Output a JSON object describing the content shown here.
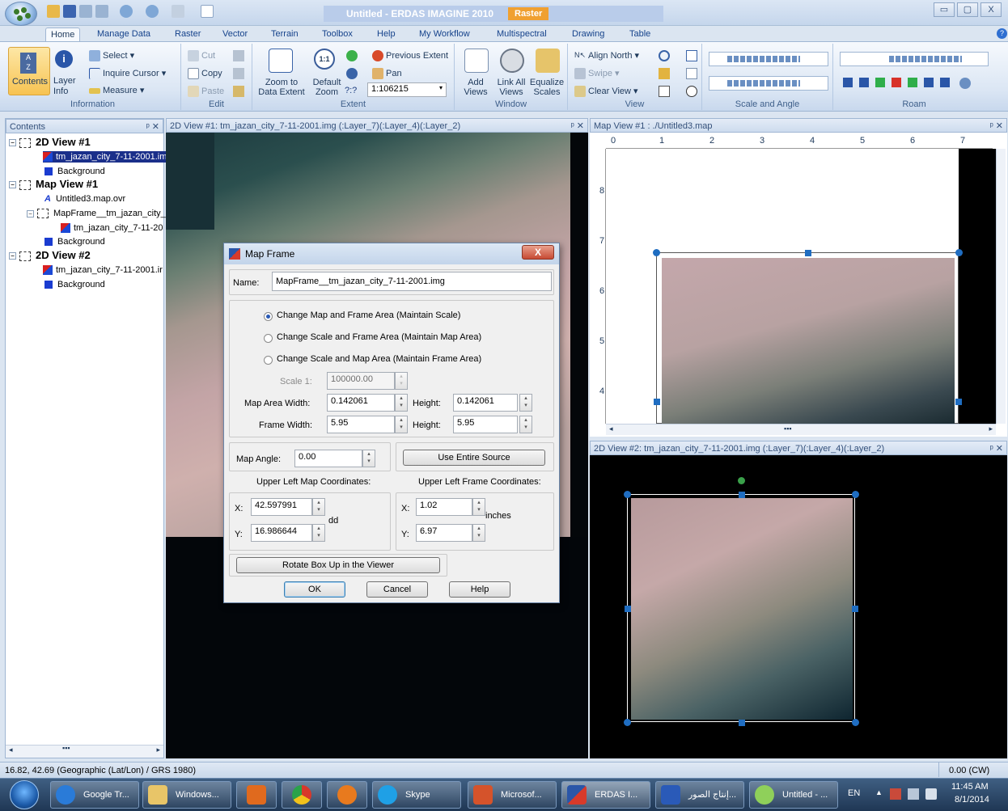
{
  "window": {
    "title": "Untitled - ERDAS IMAGINE 2010",
    "context_tab": "Raster",
    "minimize": "▭",
    "maximize": "▢",
    "close": "X",
    "help_icon": "help-icon"
  },
  "tabs": [
    "Home",
    "Manage Data",
    "Raster",
    "Vector",
    "Terrain",
    "Toolbox",
    "Help",
    "My Workflow",
    "Multispectral",
    "Drawing",
    "Table"
  ],
  "ribbon": {
    "information": {
      "label": "Information",
      "contents": "Contents",
      "layer_info": "Layer Info",
      "select": "Select",
      "inquire_cursor": "Inquire Cursor",
      "measure": "Measure"
    },
    "edit": {
      "label": "Edit",
      "cut": "Cut",
      "copy": "Copy",
      "paste": "Paste"
    },
    "extent": {
      "label": "Extent",
      "zoom_to_data_extent": "Zoom to Data Extent",
      "default_zoom": "Default Zoom",
      "unknown_scale": "?:?",
      "scale_value": "1:106215",
      "previous_extent": "Previous Extent",
      "pan": "Pan",
      "one_to_one": "1:1"
    },
    "window": {
      "label": "Window",
      "add_views": "Add Views",
      "link_all_views": "Link All Views",
      "equalize_scales": "Equalize Scales"
    },
    "view": {
      "label": "View",
      "align_north": "Align North",
      "swipe": "Swipe",
      "clear_view": "Clear View"
    },
    "scale_and_angle": {
      "label": "Scale and Angle"
    },
    "roam": {
      "label": "Roam"
    }
  },
  "contents_panel": {
    "title": "Contents",
    "items": [
      {
        "label": "2D View #1"
      },
      {
        "label": "tm_jazan_city_7-11-2001.im"
      },
      {
        "label": "Background"
      },
      {
        "label": "Map View #1"
      },
      {
        "label": "Untitled3.map.ovr"
      },
      {
        "label": "MapFrame__tm_jazan_city_"
      },
      {
        "label": "tm_jazan_city_7-11-20"
      },
      {
        "label": "Background"
      },
      {
        "label": "2D View #2"
      },
      {
        "label": "tm_jazan_city_7-11-2001.ir"
      },
      {
        "label": "Background"
      }
    ]
  },
  "views": {
    "view1_title": "2D View #1: tm_jazan_city_7-11-2001.img (:Layer_7)(:Layer_4)(:Layer_2)",
    "map_view_title": "Map View #1 : ./Untitled3.map",
    "view2_title": "2D View #2: tm_jazan_city_7-11-2001.img (:Layer_7)(:Layer_4)(:Layer_2)",
    "ruler_top": [
      "0",
      "1",
      "2",
      "3",
      "4",
      "5",
      "6",
      "7"
    ],
    "ruler_left": [
      "8",
      "7",
      "6",
      "5",
      "4"
    ],
    "pin": "ᵖ ✕"
  },
  "dialog": {
    "title": "Map Frame",
    "close": "X",
    "name_label": "Name:",
    "name_value": "MapFrame__tm_jazan_city_7-11-2001.img",
    "options": [
      "Change Map and Frame Area (Maintain Scale)",
      "Change Scale and Frame Area (Maintain Map Area)",
      "Change Scale and Map Area (Maintain Frame Area)"
    ],
    "selected_option": 0,
    "scale_label": "Scale 1:",
    "scale_value": "100000.00",
    "map_area_width_label": "Map Area Width:",
    "map_area_width": "0.142061",
    "map_area_height_label": "Height:",
    "map_area_height": "0.142061",
    "frame_width_label": "Frame Width:",
    "frame_width": "5.95",
    "frame_height_label": "Height:",
    "frame_height": "5.95",
    "map_angle_label": "Map Angle:",
    "map_angle": "0.00",
    "use_entire_source": "Use Entire Source",
    "ul_map_title": "Upper Left Map Coordinates:",
    "ul_frame_title": "Upper Left Frame Coordinates:",
    "x_label": "X:",
    "y_label": "Y:",
    "map_x": "42.597991",
    "map_y": "16.986644",
    "map_unit": "dd",
    "frame_x": "1.02",
    "frame_y": "6.97",
    "frame_unit": "inches",
    "rotate_button": "Rotate Box Up in the Viewer",
    "ok": "OK",
    "cancel": "Cancel",
    "help": "Help"
  },
  "status": {
    "coords": "16.82, 42.69  (Geographic (Lat/Lon) / GRS 1980)",
    "rotation": "0.00 (CW)"
  },
  "taskbar": {
    "items": [
      "Google Tr...",
      "Windows...",
      "",
      "",
      "",
      "Skype",
      "Microsof...",
      "ERDAS I...",
      "إنتاج الصور...",
      "Untitled - ..."
    ],
    "lang": "EN",
    "time": "11:45 AM",
    "date": "8/1/2014"
  }
}
